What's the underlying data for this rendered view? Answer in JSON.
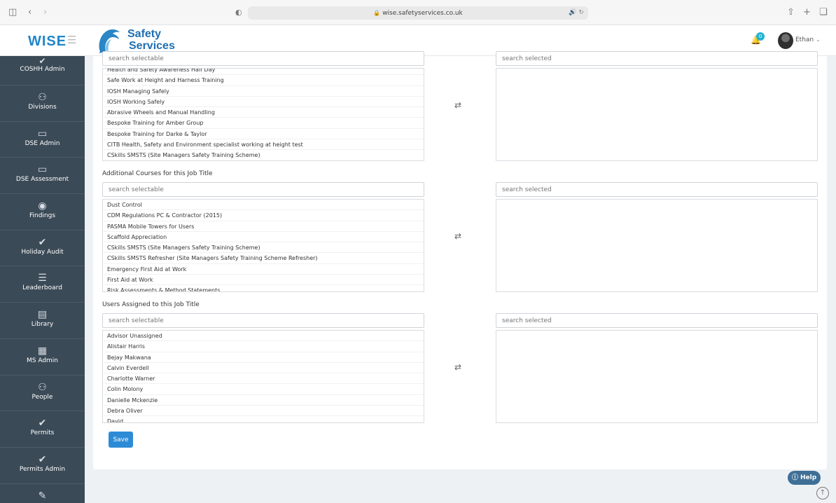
{
  "browser": {
    "url": "wise.safetyservices.co.uk"
  },
  "sidebar": {
    "brand": "WISE",
    "items": [
      {
        "label": "COSHH Admin",
        "icon": "check-icon"
      },
      {
        "label": "Divisions",
        "icon": "users-icon"
      },
      {
        "label": "DSE Admin",
        "icon": "monitor-icon"
      },
      {
        "label": "DSE Assessment",
        "icon": "monitor-icon"
      },
      {
        "label": "Findings",
        "icon": "eye-icon"
      },
      {
        "label": "Holiday Audit",
        "icon": "check-icon"
      },
      {
        "label": "Leaderboard",
        "icon": "list-icon"
      },
      {
        "label": "Library",
        "icon": "book-icon"
      },
      {
        "label": "MS Admin",
        "icon": "table-icon"
      },
      {
        "label": "People",
        "icon": "users-icon"
      },
      {
        "label": "Permits",
        "icon": "check-icon"
      },
      {
        "label": "Permits Admin",
        "icon": "check-icon"
      },
      {
        "label": "",
        "icon": "pencil-icon"
      }
    ]
  },
  "header": {
    "logo_line1": "Safety",
    "logo_line2": "Services",
    "notification_count": "0",
    "username": "Ethan"
  },
  "sections": [
    {
      "label": "",
      "search_selectable_placeholder": "search selectable",
      "search_selected_placeholder": "search selected",
      "options": [
        "Health and Safety Awareness Half Day",
        "Safe Work at Height and Harness Training",
        "IOSH Managing Safely",
        "IOSH Working Safely",
        "Abrasive Wheels and Manual Handling",
        "Bespoke Training for Amber Group",
        "Bespoke Training for Darke & Taylor",
        "CITB Health, Safety and Environment specialist working at height test",
        "CSkills SMSTS (Site Managers Safety Training Scheme)"
      ]
    },
    {
      "label": "Additional Courses for this Job Title",
      "search_selectable_placeholder": "search selectable",
      "search_selected_placeholder": "search selected",
      "options": [
        "Dust Control",
        "CDM Regulations PC & Contractor (2015)",
        "PASMA Mobile Towers for Users",
        "Scaffold Appreciation",
        "CSkills SMSTS (Site Managers Safety Training Scheme)",
        "CSkills SMSTS Refresher (Site Managers Safety Training Scheme Refresher)",
        "Emergency First Aid at Work",
        "First Aid at Work",
        "Risk Assessments & Method Statements"
      ]
    },
    {
      "label": "Users Assigned to this Job Title",
      "search_selectable_placeholder": "search selectable",
      "search_selected_placeholder": "search selected",
      "options": [
        "Advisor Unassigned",
        "Alistair Harris",
        "Bejay Makwana",
        "Calvin Everdell",
        "Charlotte Warner",
        "Colin Molony",
        "Danielle Mckenzie",
        "Debra Oliver",
        "David ..."
      ]
    }
  ],
  "actions": {
    "save_label": "Save",
    "help_label": "Help"
  }
}
